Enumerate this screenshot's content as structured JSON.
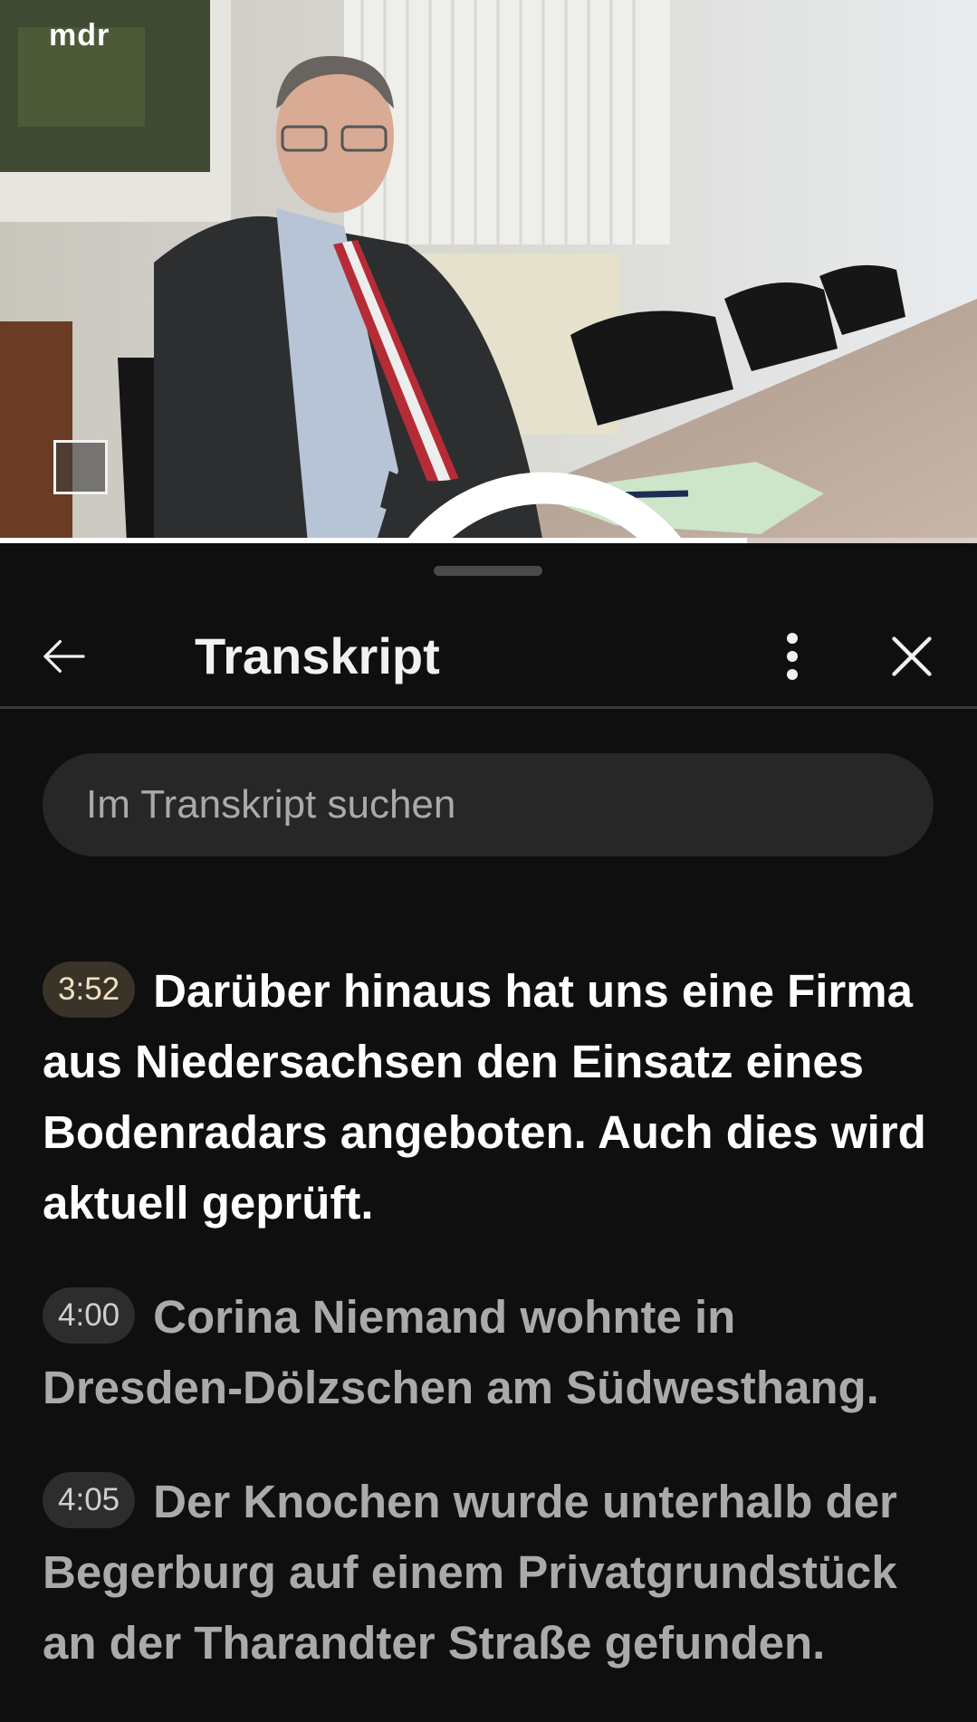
{
  "video": {
    "channel_logo": "mdr",
    "overlay_icon": "fingerprint-icon",
    "progress_fraction": 0.765
  },
  "panel": {
    "title": "Transkript",
    "back_icon": "arrow-left-icon",
    "more_icon": "more-vertical-icon",
    "close_icon": "close-icon"
  },
  "search": {
    "placeholder": "Im Transkript suchen",
    "value": ""
  },
  "segments": [
    {
      "time": "3:52",
      "text": "Darüber hinaus hat uns eine Firma aus Niedersachsen den Einsatz eines Bodenradars angeboten. Auch dies wird aktuell geprüft.",
      "active": true
    },
    {
      "time": "4:00",
      "text": "Corina Niemand wohnte in Dresden-Dölzschen am Südwesthang.",
      "active": false
    },
    {
      "time": "4:05",
      "text": "Der Knochen wurde unterhalb der Begerburg auf einem Privatgrundstück an der Tharandter Straße gefunden.",
      "active": false
    }
  ],
  "colors": {
    "background": "#0f0f0f",
    "active_text": "#ffffff",
    "inactive_text": "#aaaaaa",
    "active_timestamp_bg": "#3a3428",
    "search_bg": "#272727"
  }
}
